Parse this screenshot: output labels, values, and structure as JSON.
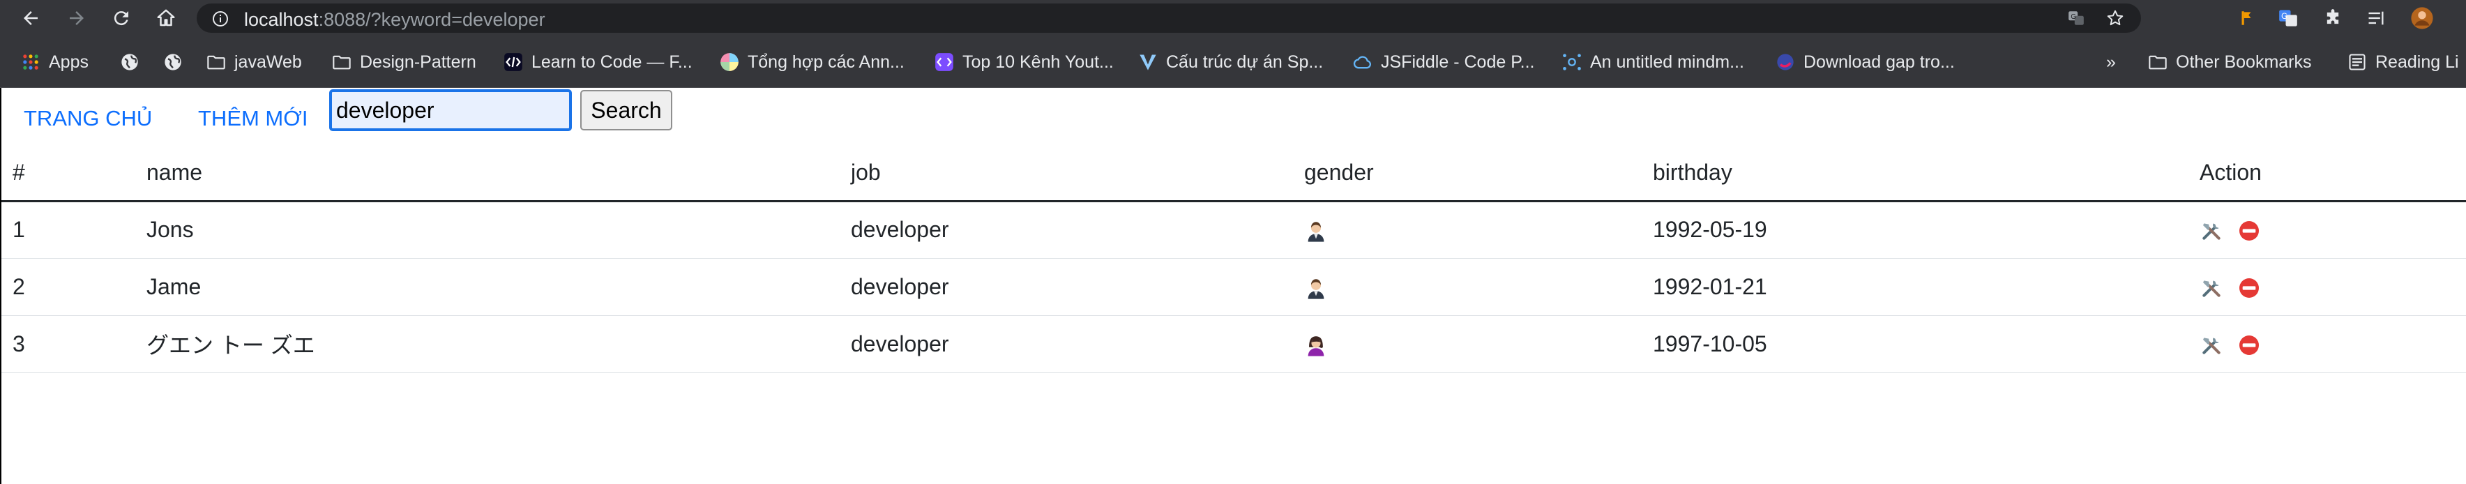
{
  "browser": {
    "url_host": "localhost",
    "url_rest": ":8088/?keyword=developer",
    "bookmarks": [
      {
        "label": "Apps",
        "icon": "apps-grid-icon"
      },
      {
        "label": "",
        "icon": "globe-icon"
      },
      {
        "label": "",
        "icon": "globe-icon"
      },
      {
        "label": "javaWeb",
        "icon": "folder-icon"
      },
      {
        "label": "Design-Pattern",
        "icon": "folder-icon"
      },
      {
        "label": "Learn to Code — F...",
        "icon": "code-badge-icon"
      },
      {
        "label": "Tổng hợp các Ann...",
        "icon": "color-wheel-icon"
      },
      {
        "label": "Top 10 Kênh Yout...",
        "icon": "code-badge-icon"
      },
      {
        "label": "Cấu trúc dự án Sp...",
        "icon": "v-logo-icon"
      },
      {
        "label": "JSFiddle - Code P...",
        "icon": "cloud-icon"
      },
      {
        "label": "An untitled mindm...",
        "icon": "mindmap-icon"
      },
      {
        "label": "Download gap tro...",
        "icon": "swirl-icon"
      }
    ],
    "overflow": "»",
    "other_bookmarks": "Other Bookmarks",
    "reading_list": "Reading Li"
  },
  "nav": {
    "home": "TRANG CHỦ",
    "add_new": "THÊM MỚI"
  },
  "search": {
    "value": "developer",
    "button": "Search"
  },
  "table": {
    "headers": [
      "#",
      "name",
      "job",
      "gender",
      "birthday",
      "Action"
    ],
    "rows": [
      {
        "id": "1",
        "name": "Jons",
        "job": "developer",
        "gender": "male",
        "birthday": "1992-05-19"
      },
      {
        "id": "2",
        "name": "Jame",
        "job": "developer",
        "gender": "male",
        "birthday": "1992-01-21"
      },
      {
        "id": "3",
        "name": "グエン トー ズエ",
        "job": "developer",
        "gender": "female",
        "birthday": "1997-10-05"
      }
    ]
  },
  "colors": {
    "link": "#0d6efd",
    "chrome": "#35363a",
    "omnibox": "#202124"
  }
}
